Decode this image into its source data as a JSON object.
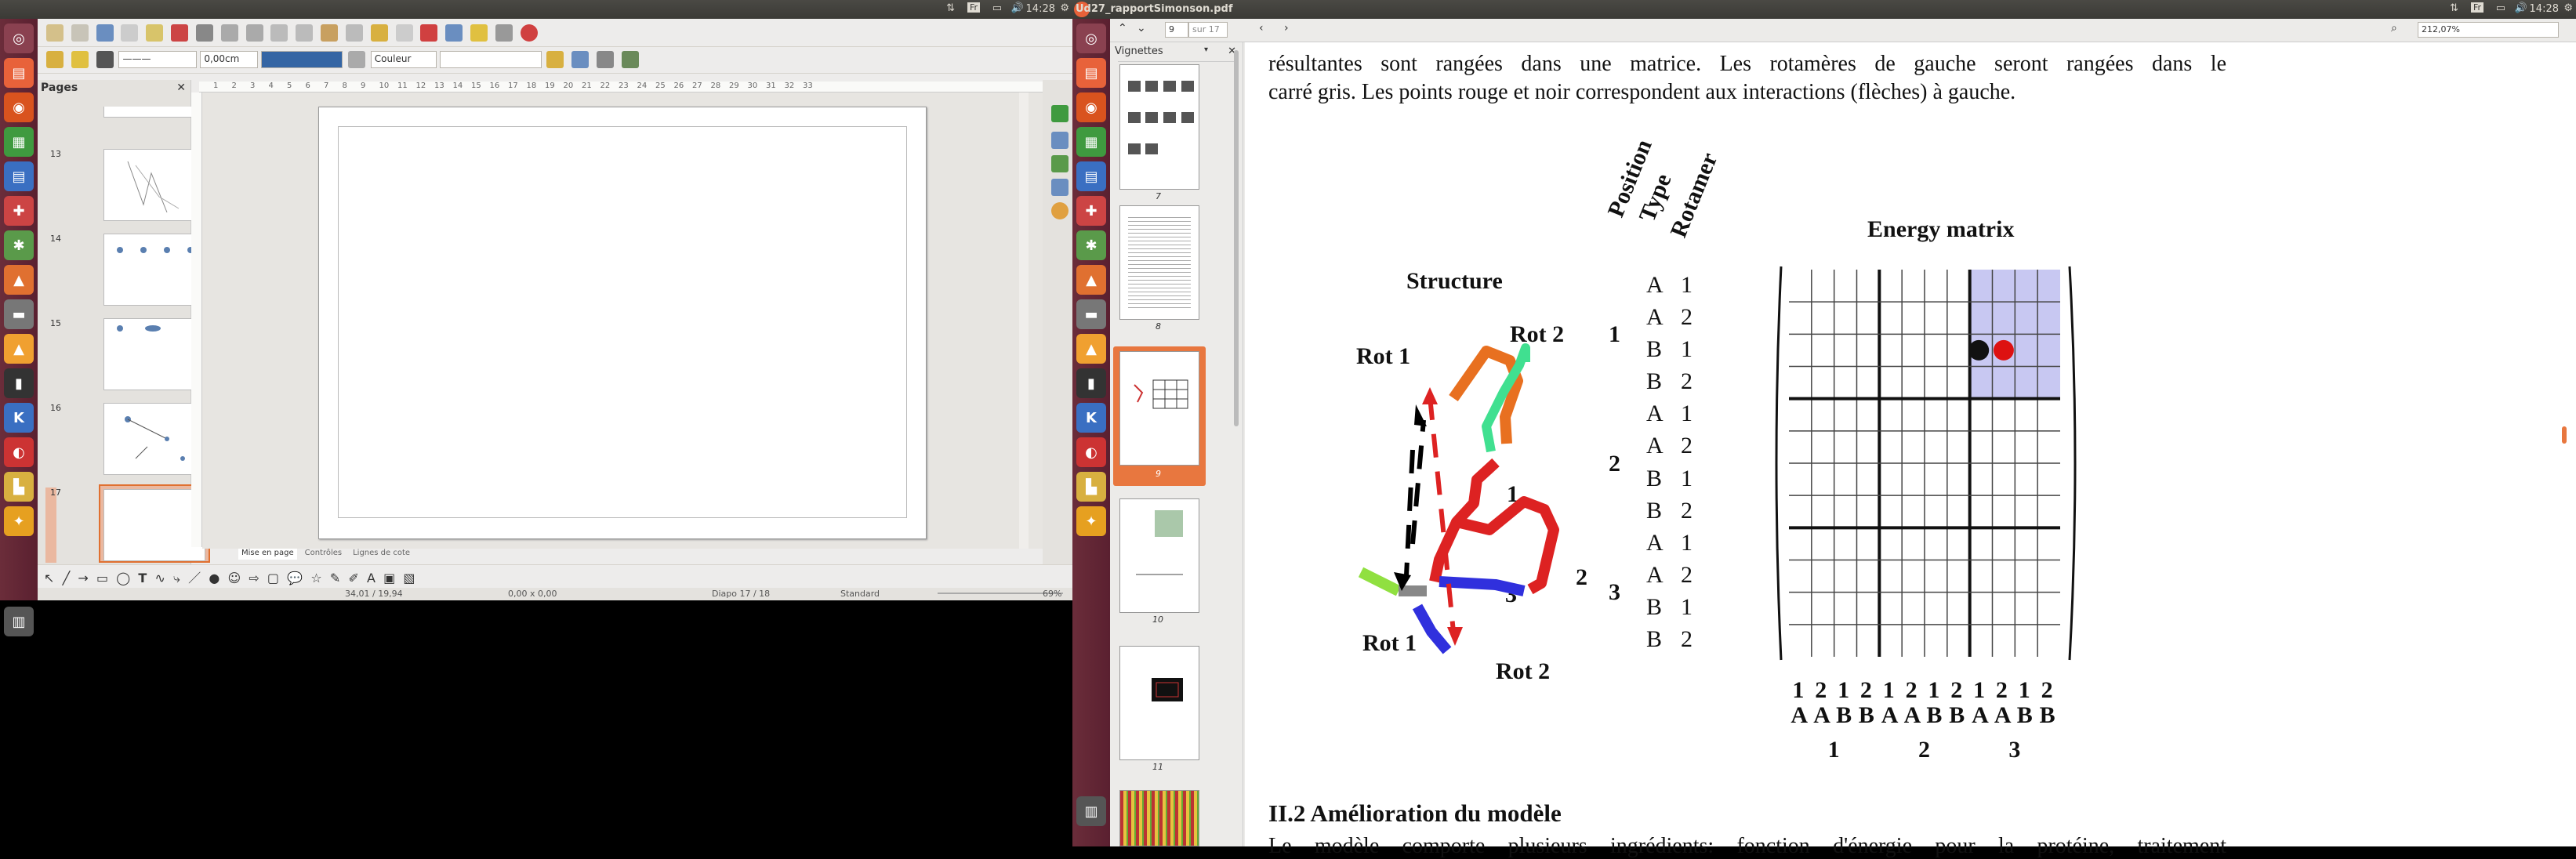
{
  "left_topbar": {
    "time": "14:28",
    "kb": "Fr"
  },
  "right_topbar": {
    "title": "Ud27_rapportSimonson.pdf",
    "time": "14:28",
    "kb": "Fr"
  },
  "impress": {
    "line_width": "0,00cm",
    "fill_label": "Couleur",
    "pages_title": "Pages",
    "slides": [
      "13",
      "14",
      "15",
      "16",
      "17"
    ],
    "tabs": [
      "Mise en page",
      "Contrôles",
      "Lignes de cote"
    ],
    "ruler": [
      "1",
      "2",
      "3",
      "4",
      "5",
      "6",
      "7",
      "8",
      "9",
      "10",
      "11",
      "12",
      "13",
      "14",
      "15",
      "16",
      "17",
      "18",
      "19",
      "20",
      "21",
      "22",
      "23",
      "24",
      "25",
      "26",
      "27",
      "28",
      "29",
      "30",
      "31",
      "32",
      "33"
    ],
    "status": {
      "pos": "34,01 / 19,94",
      "size": "0,00 x 0,00",
      "slide": "Diapo 17 / 18",
      "layout": "Standard",
      "zoom": "69%"
    }
  },
  "evince": {
    "page_input": "9",
    "page_of": "sur 17",
    "zoom": "212,07%",
    "sidebar_title": "Vignettes",
    "thumb_labels": [
      "7",
      "8",
      "9",
      "10",
      "11"
    ],
    "text_top_1": "résultantes sont rangées dans une matrice. Les rotamères de gauche seront rangées dans le",
    "text_top_2": "carré gris. Les points rouge et noir correspondent aux interactions (flèches) à gauche.",
    "figure": {
      "structure_title": "Structure",
      "rot1_top": "Rot 1",
      "rot2_top": "Rot 2",
      "rot1_bottom": "Rot 1",
      "rot2_bottom": "Rot 2",
      "res_labels": [
        "1",
        "2",
        "3"
      ],
      "header": [
        "Position",
        "Type",
        "Rotamer"
      ],
      "matrix_title": "Energy matrix",
      "row_pos": [
        "A",
        "A",
        "B",
        "B",
        "A",
        "A",
        "B",
        "B",
        "A",
        "A",
        "B",
        "B"
      ],
      "row_rot": [
        "1",
        "2",
        "1",
        "2",
        "1",
        "2",
        "1",
        "2",
        "1",
        "2",
        "1",
        "2"
      ],
      "row_groups": [
        "1",
        "2",
        "3"
      ],
      "col_rot": [
        "1",
        "2",
        "1",
        "2",
        "1",
        "2",
        "1",
        "2",
        "1",
        "2",
        "1",
        "2"
      ],
      "col_pos": [
        "A",
        "A",
        "B",
        "B",
        "A",
        "A",
        "B",
        "B",
        "A",
        "A",
        "B",
        "B"
      ],
      "col_groups": [
        "1",
        "2",
        "3"
      ]
    },
    "section_heading": "II.2 Amélioration du modèle",
    "text_bottom": "Le modèle comporte plusieurs ingrédients: fonction d'énergie pour la protéine, traitement"
  }
}
